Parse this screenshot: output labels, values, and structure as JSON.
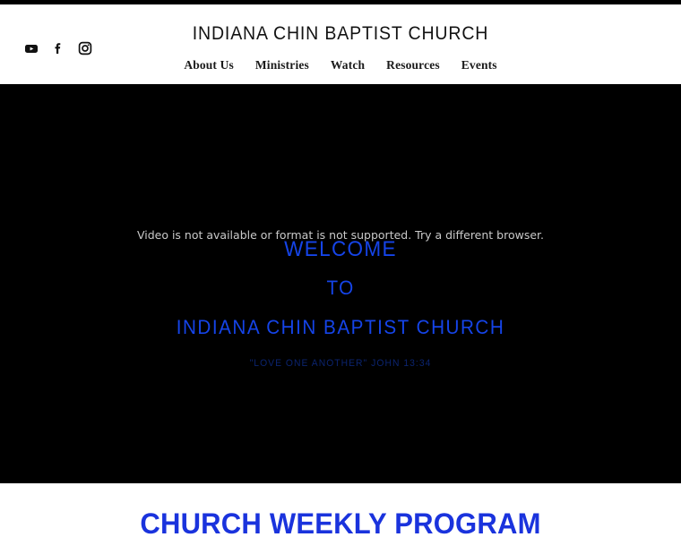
{
  "top_strip": {
    "color": "#000000"
  },
  "header": {
    "brand_title": "INDIANA CHIN BAPTIST CHURCH",
    "social": [
      {
        "name": "youtube-icon",
        "label": "YouTube"
      },
      {
        "name": "facebook-icon",
        "label": "Facebook"
      },
      {
        "name": "instagram-icon",
        "label": "Instagram"
      }
    ],
    "nav": [
      {
        "label": "About Us"
      },
      {
        "label": "Ministries"
      },
      {
        "label": "Watch"
      },
      {
        "label": "Resources"
      },
      {
        "label": "Events"
      }
    ]
  },
  "hero": {
    "background": "#000000",
    "video_fallback": "Video is not available or format is not supported. Try a different browser.",
    "line_1": "WELCOME",
    "line_2": "TO",
    "line_3": "INDIANA CHIN BAPTIST CHURCH",
    "verse": "\"LOVE ONE ANOTHER\" JOHN 13:34",
    "accent_color": "#1544e8",
    "verse_color": "#0b2470",
    "fallback_color": "#c9c9c9"
  },
  "program": {
    "heading": "CHURCH WEEKLY PROGRAM",
    "heading_color": "#1a33dd"
  }
}
